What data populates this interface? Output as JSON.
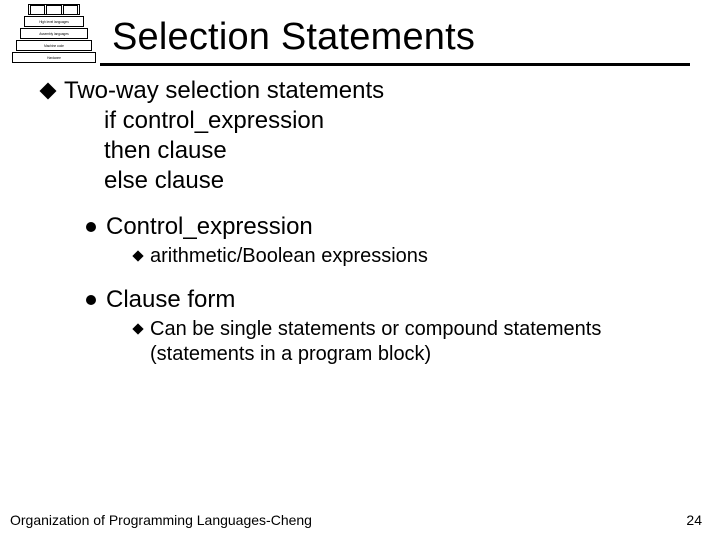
{
  "pyramid": {
    "top": [
      "",
      "",
      ""
    ],
    "l2": "High level languages",
    "l3": "Assembly languages",
    "l4": "Machine code",
    "l5": "Hardware"
  },
  "title": "Selection Statements",
  "body": {
    "line1": "Two-way selection statements",
    "indent1": "if control_expression",
    "indent2": " then  clause",
    "indent3": " else   clause",
    "sub1": "Control_expression",
    "sub1a": "arithmetic/Boolean expressions",
    "sub2": "Clause form",
    "sub2a": "Can be single statements or compound statements (statements in a program block)"
  },
  "footer": {
    "left": "Organization of Programming Languages-Cheng",
    "right": "24"
  }
}
